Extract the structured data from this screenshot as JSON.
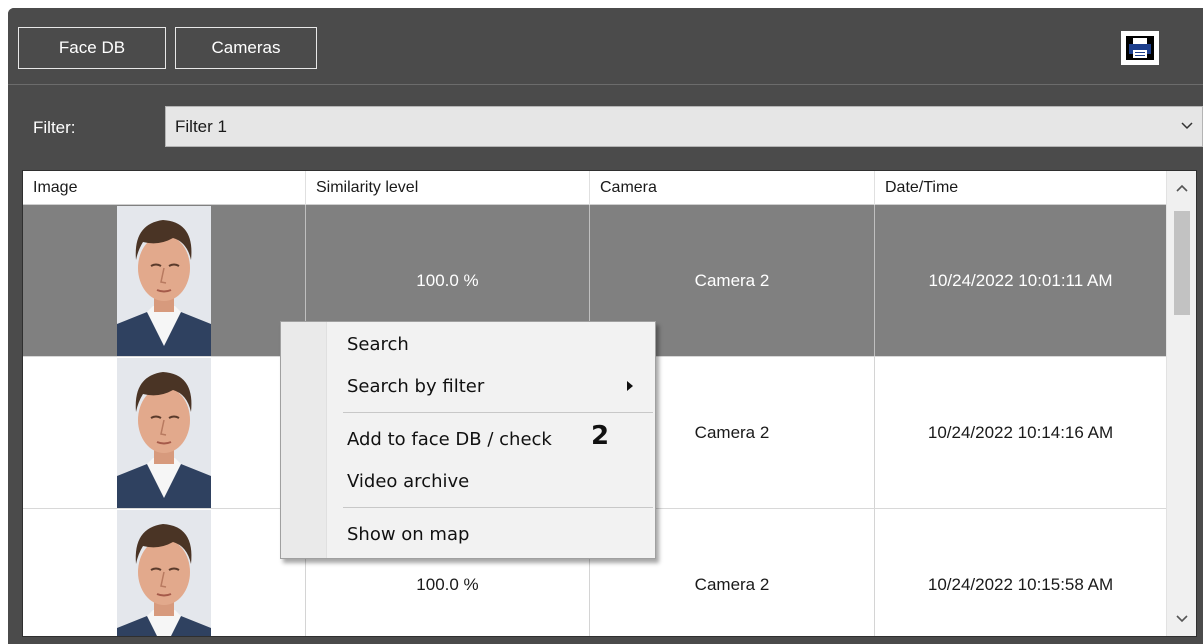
{
  "toolbar": {
    "face_db_label": "Face DB",
    "cameras_label": "Cameras",
    "print_icon": "printer-icon"
  },
  "filter": {
    "label": "Filter:",
    "value": "Filter 1"
  },
  "grid": {
    "columns": [
      "Image",
      "Similarity level",
      "Camera",
      "Date/Time"
    ],
    "rows": [
      {
        "similarity": "100.0 %",
        "camera": "Camera 2",
        "datetime": "10/24/2022 10:01:11 AM",
        "selected": true
      },
      {
        "similarity": "",
        "camera": "Camera 2",
        "datetime": "10/24/2022 10:14:16 AM",
        "selected": false
      },
      {
        "similarity": "100.0 %",
        "camera": "Camera 2",
        "datetime": "10/24/2022 10:15:58 AM",
        "selected": false
      }
    ]
  },
  "context_menu": {
    "items": [
      "Search",
      "Search by filter",
      "Add to face DB / check",
      "Video archive",
      "Show on map"
    ],
    "badge": "2"
  },
  "colors": {
    "window_bg": "#4b4b4b",
    "selected_row": "#808080",
    "menu_bg": "#f2f2f2"
  }
}
